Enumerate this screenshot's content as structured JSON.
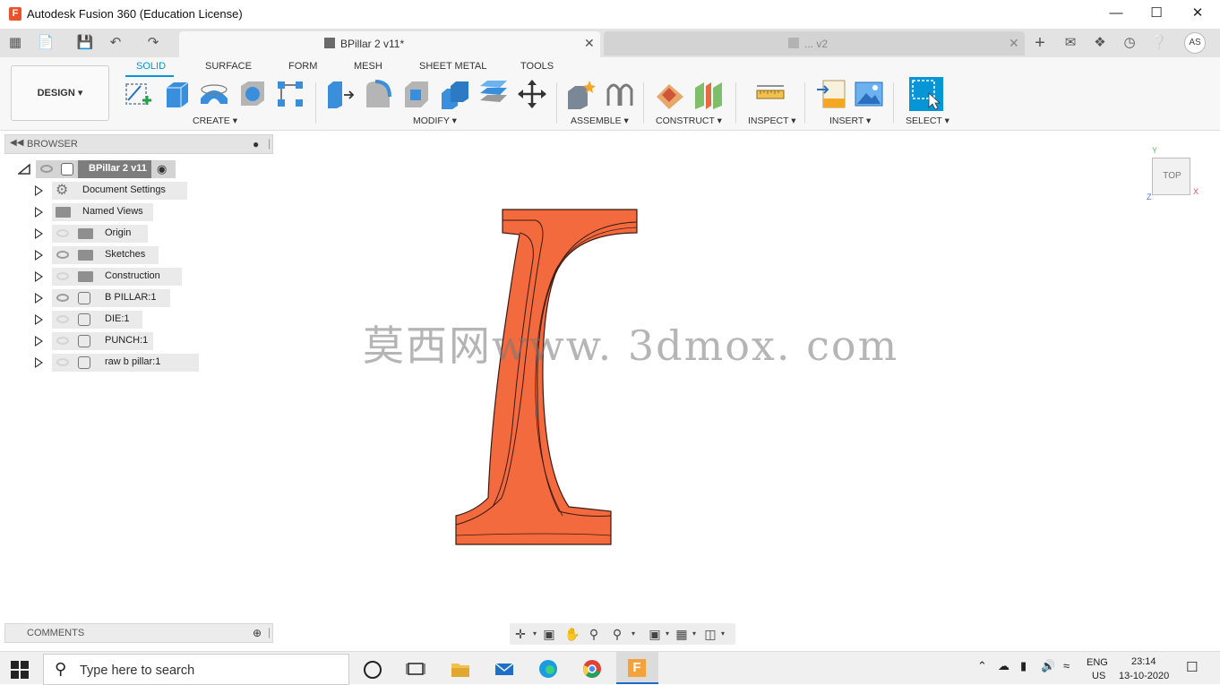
{
  "window": {
    "title": "Autodesk Fusion 360 (Education License)",
    "logo_letter": "F"
  },
  "tabs": [
    {
      "label": "BPillar 2 v11*",
      "active": true
    },
    {
      "label": "... v2",
      "active": false
    }
  ],
  "user": {
    "initials": "AS"
  },
  "ribbon": {
    "workspace": "DESIGN",
    "tabs": [
      "SOLID",
      "SURFACE",
      "FORM",
      "MESH",
      "SHEET METAL",
      "TOOLS"
    ],
    "groups": [
      "CREATE",
      "MODIFY",
      "ASSEMBLE",
      "CONSTRUCT",
      "INSPECT",
      "INSERT",
      "SELECT"
    ]
  },
  "browser": {
    "title": "BROWSER",
    "root": "BPillar 2 v11",
    "items": [
      {
        "label": "Document Settings",
        "icon": "gear-icon",
        "eye": "none"
      },
      {
        "label": "Named Views",
        "icon": "folder-icon",
        "eye": "none"
      },
      {
        "label": "Origin",
        "icon": "folder-icon",
        "eye": "hidden"
      },
      {
        "label": "Sketches",
        "icon": "folder-icon",
        "eye": "visible"
      },
      {
        "label": "Construction",
        "icon": "folder-icon",
        "eye": "hidden"
      },
      {
        "label": "B PILLAR:1",
        "icon": "body-icon",
        "eye": "visible"
      },
      {
        "label": "DIE:1",
        "icon": "body-icon",
        "eye": "hidden"
      },
      {
        "label": "PUNCH:1",
        "icon": "body-icon",
        "eye": "hidden"
      },
      {
        "label": "raw b  pillar:1",
        "icon": "body-icon",
        "eye": "hidden"
      }
    ]
  },
  "comments": {
    "title": "COMMENTS"
  },
  "viewcube": {
    "face": "TOP",
    "axis_y": "Y",
    "axis_x": "X",
    "axis_z": "Z"
  },
  "viewport": {
    "watermark": "莫西网www. 3dmox. com",
    "part_color": "#f26a3d"
  },
  "taskbar": {
    "search_placeholder": "Type here to search",
    "lang_1": "ENG",
    "lang_2": "US",
    "time": "23:14",
    "date": "13-10-2020"
  },
  "colors": {
    "accent": "#0696d7",
    "part": "#f26a3d"
  }
}
